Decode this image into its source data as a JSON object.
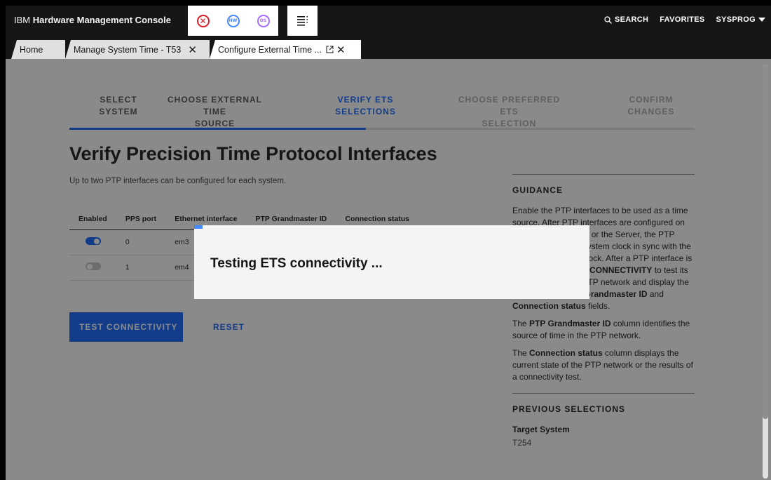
{
  "header": {
    "brand_prefix": "IBM",
    "brand_name": "Hardware Management Console",
    "search_label": "SEARCH",
    "favorites_label": "FAVORITES",
    "user_label": "SYSPROG",
    "hw_badge": "HW",
    "os_badge": "OS"
  },
  "tabs": [
    {
      "label": "Home"
    },
    {
      "label": "Manage System Time - T53"
    },
    {
      "label": "Configure External Time ..."
    }
  ],
  "steps": [
    {
      "line1": "SELECT",
      "line2": "SYSTEM"
    },
    {
      "line1": "CHOOSE EXTERNAL TIME",
      "line2": "SOURCE"
    },
    {
      "line1": "VERIFY ETS",
      "line2": "SELECTIONS"
    },
    {
      "line1": "CHOOSE PREFERRED ETS",
      "line2": "SELECTION"
    },
    {
      "line1": "CONFIRM",
      "line2": "CHANGES"
    }
  ],
  "page": {
    "title": "Verify Precision Time Protocol Interfaces",
    "subtitle": "Up to two PTP interfaces can be configured for each system."
  },
  "table": {
    "headers": [
      "Enabled",
      "PPS port",
      "Ethernet interface",
      "PTP Grandmaster ID",
      "Connection status"
    ],
    "rows": [
      {
        "enabled": true,
        "pps_port": "0",
        "ethernet": "em3",
        "grandmaster": "",
        "status": ""
      },
      {
        "enabled": false,
        "pps_port": "1",
        "ethernet": "em4",
        "grandmaster": "",
        "status": ""
      }
    ]
  },
  "buttons": {
    "test": "TEST CONNECTIVITY",
    "reset": "RESET"
  },
  "guidance": {
    "heading": "GUIDANCE",
    "p1_a": "Enable the PTP interfaces to be used as a time source. After PTP interfaces are configured on the Support Element or the Server, the PTP network keeps the system clock in sync with the PTP Grandmaster clock. After a PTP interface is enabled, click ",
    "p1_b": "TEST CONNECTIVITY",
    "p1_c": " to test its connectivity to the PTP network and display the results for the ",
    "p1_d": "PTP Grandmaster ID",
    "p1_e": " and ",
    "p1_f": "Connection status",
    "p1_g": " fields.",
    "p2_a": "The ",
    "p2_b": "PTP Grandmaster ID",
    "p2_c": " column identifies the source of time in the PTP network.",
    "p3_a": "The ",
    "p3_b": "Connection status",
    "p3_c": " column displays the current state of the PTP network or the results of a connectivity test."
  },
  "previous": {
    "heading": "PREVIOUS SELECTIONS",
    "target_label": "Target System",
    "target_value": "T254"
  },
  "modal": {
    "text": "Testing ETS connectivity ..."
  },
  "colors": {
    "accent": "#0f62fe",
    "topbar": "#161616",
    "close_red": "#da1e28",
    "hw_blue": "#4589ff",
    "os_purple": "#a56eff"
  }
}
